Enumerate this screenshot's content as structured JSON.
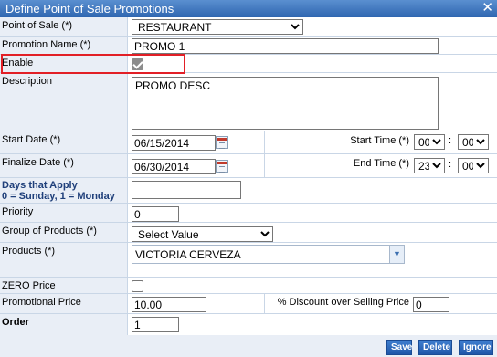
{
  "window": {
    "title": "Define Point of Sale Promotions",
    "close_glyph": "✕"
  },
  "fields": {
    "point_of_sale": {
      "label": "Point of Sale (*)",
      "value": "RESTAURANT"
    },
    "promotion_name": {
      "label": "Promotion Name (*)",
      "value": "PROMO 1"
    },
    "enable": {
      "label": "Enable",
      "checked": true
    },
    "description": {
      "label": "Description",
      "value": "PROMO DESC"
    },
    "start_date": {
      "label": "Start Date (*)",
      "value": "06/15/2014"
    },
    "start_time": {
      "label": "Start Time (*)",
      "hour": "00",
      "minute": "00",
      "separator": ":"
    },
    "finalize_date": {
      "label": "Finalize Date (*)",
      "value": "06/30/2014"
    },
    "end_time": {
      "label": "End Time (*)",
      "hour": "23",
      "minute": "00",
      "separator": ":"
    },
    "days": {
      "label_line1": "Days that Apply",
      "label_line2": "0 = Sunday, 1 = Monday ...",
      "value": ""
    },
    "priority": {
      "label": "Priority",
      "value": "0"
    },
    "group_of_products": {
      "label": "Group of Products (*)",
      "value": "Select Value"
    },
    "products": {
      "label": "Products (*)",
      "value": "VICTORIA CERVEZA"
    },
    "zero_price": {
      "label": "ZERO Price",
      "checked": false
    },
    "promotional_price": {
      "label": "Promotional Price",
      "value": "10.00"
    },
    "discount": {
      "label": "% Discount over Selling Price",
      "value": "0"
    },
    "order": {
      "label": "Order",
      "value": "1"
    }
  },
  "buttons": {
    "save": "Save",
    "delete": "Delete",
    "ignore": "Ignore"
  }
}
